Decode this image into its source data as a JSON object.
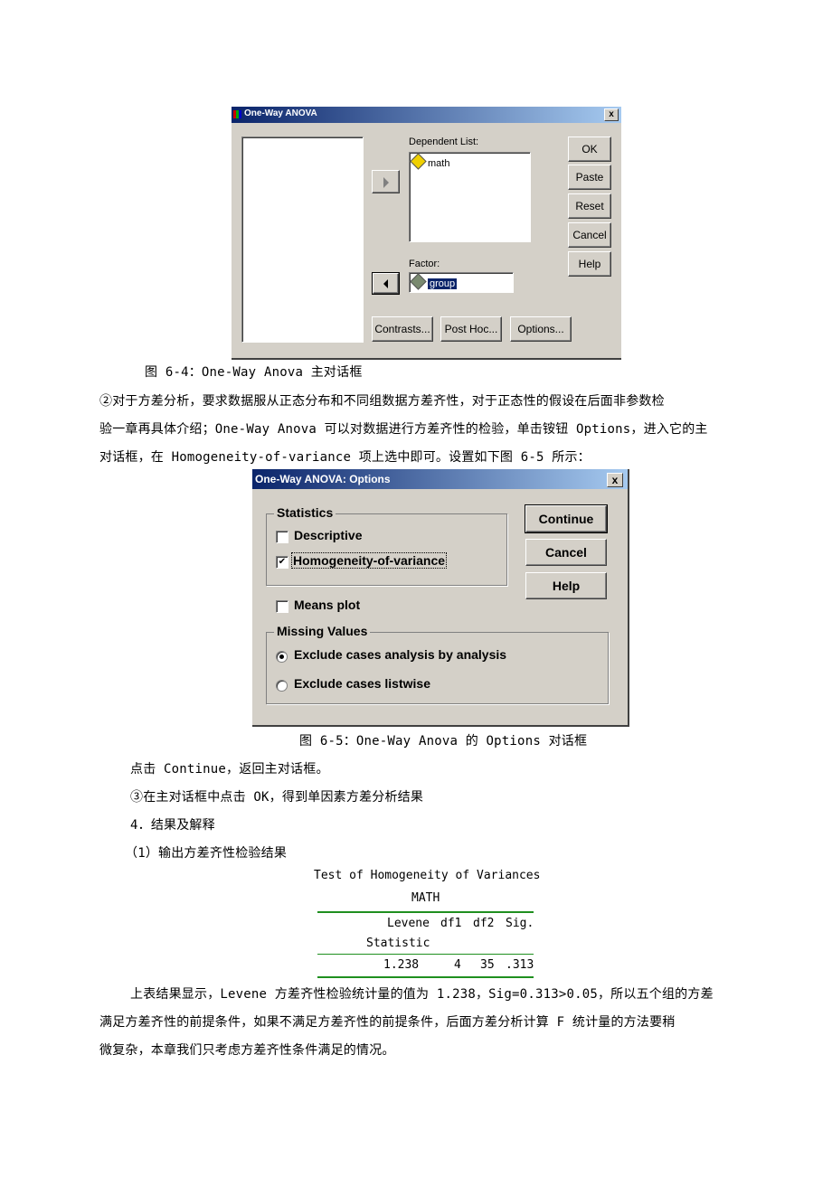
{
  "dialog1": {
    "title": "One-Way ANOVA",
    "close": "x",
    "dependent_label": "Dependent List:",
    "dependent_items": [
      "math"
    ],
    "factor_label": "Factor:",
    "factor_value": "group",
    "buttons": {
      "ok": "OK",
      "paste": "Paste",
      "reset": "Reset",
      "cancel": "Cancel",
      "help": "Help"
    },
    "bottom_buttons": {
      "contrasts": "Contrasts...",
      "posthoc": "Post Hoc...",
      "options": "Options..."
    }
  },
  "caption1": "图 6-4：One-Way Anova 主对话框",
  "para1": [
    "②对于方差分析，要求数据服从正态分布和不同组数据方差齐性，对于正态性的假设在后面非参数检",
    "验一章再具体介绍；One-Way Anova 可以对数据进行方差齐性的检验，单击铵钮 Options，进入它的主",
    "对话框，在 Homogeneity-of-variance 项上选中即可。设置如下图 6-5 所示："
  ],
  "dialog2": {
    "title": "One-Way ANOVA: Options",
    "close": "x",
    "statistics_group": "Statistics",
    "descriptive": {
      "label": "Descriptive",
      "checked": false
    },
    "homogeneity": {
      "label": "Homogeneity-of-variance",
      "checked": true
    },
    "means_plot": {
      "label": "Means plot",
      "checked": false
    },
    "missing_group": "Missing Values",
    "missing_opt1": {
      "label": "Exclude cases analysis by analysis",
      "selected": true
    },
    "missing_opt2": {
      "label": "Exclude cases listwise",
      "selected": false
    },
    "buttons": {
      "continue": "Continue",
      "cancel": "Cancel",
      "help": "Help"
    }
  },
  "caption2": "图 6-5：One-Way Anova 的 Options 对话框",
  "line_continue": "点击 Continue，返回主对话框。",
  "line_step3": "③在主对话框中点击 OK，得到单因素方差分析结果",
  "heading4": "4．结果及解释",
  "sub1": "（1）输出方差齐性检验结果",
  "table": {
    "title": "Test of Homogeneity of Variances",
    "subtitle": "MATH",
    "headers": [
      "Levene",
      "df1",
      "df2",
      "Sig."
    ],
    "header2": "Statistic",
    "row": [
      "1.238",
      "4",
      "35",
      ".313"
    ]
  },
  "para2": [
    "上表结果显示，Levene 方差齐性检验统计量的值为 1.238，Sig=0.313>0.05，所以五个组的方差",
    "满足方差齐性的前提条件，如果不满足方差齐性的前提条件，后面方差分析计算 F 统计量的方法要稍",
    "微复杂，本章我们只考虑方差齐性条件满足的情况。"
  ]
}
